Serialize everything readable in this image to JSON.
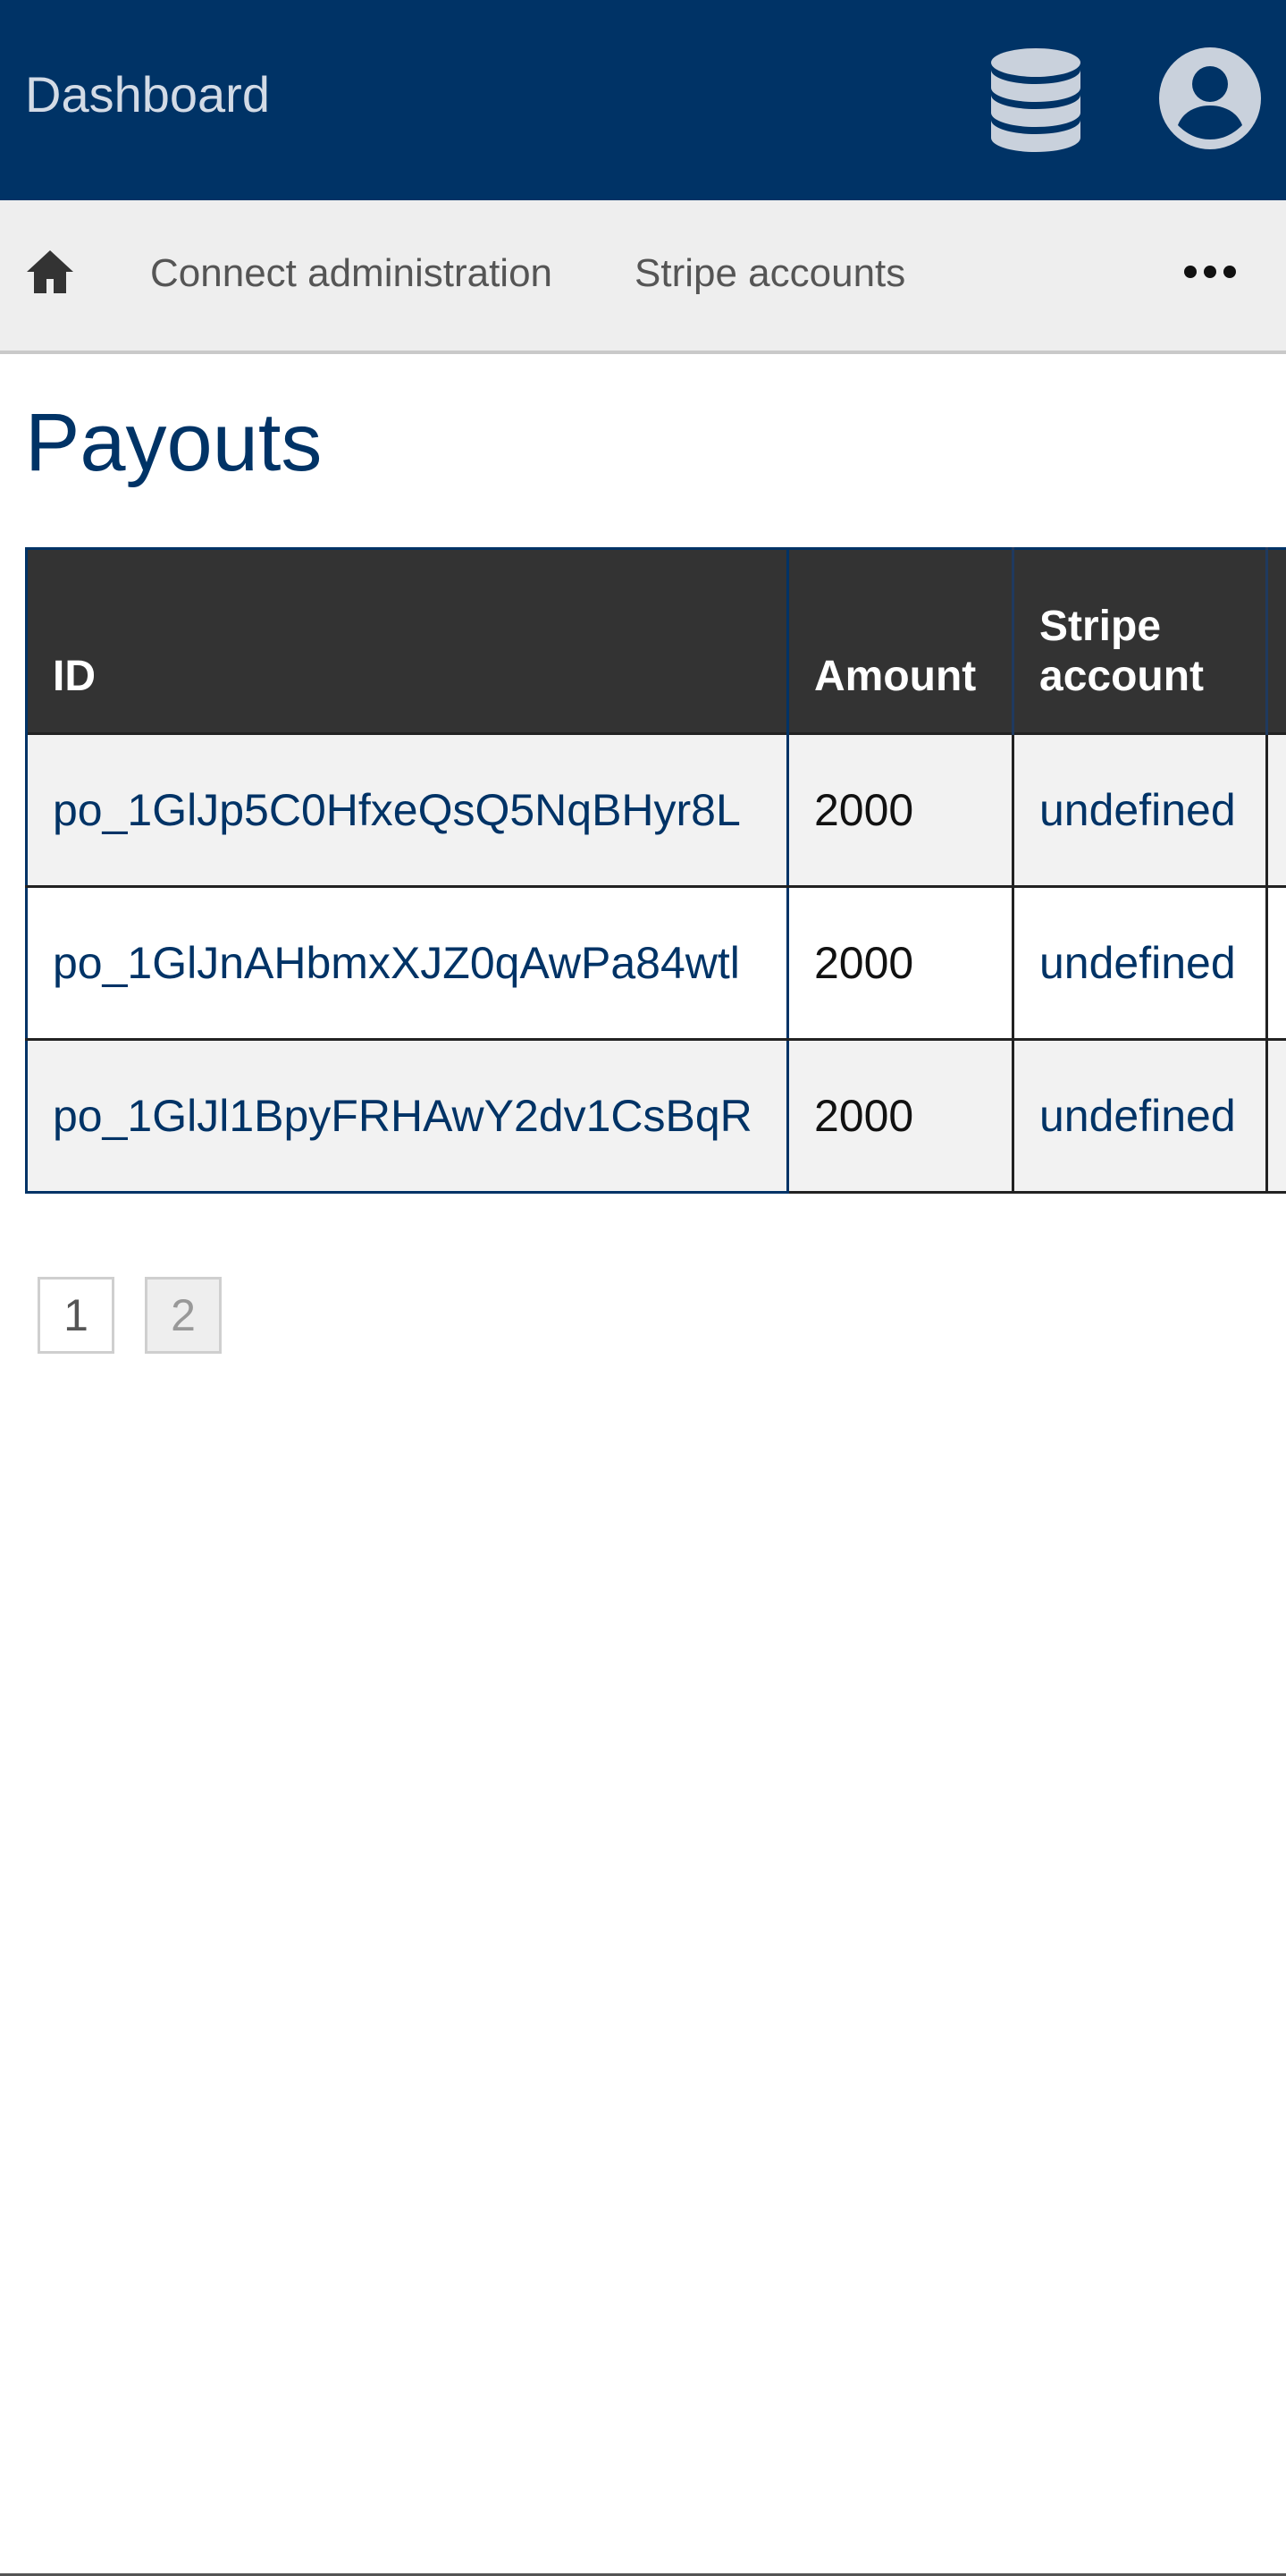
{
  "header": {
    "title": "Dashboard",
    "icons": [
      "database-icon",
      "account-circle-icon"
    ]
  },
  "breadcrumb": {
    "home_icon": "home-icon",
    "items": [
      "Connect administration",
      "Stripe accounts"
    ],
    "more_icon": "more-horizontal-icon"
  },
  "page": {
    "title": "Payouts"
  },
  "table": {
    "columns": [
      "ID",
      "Amount",
      "Stripe account"
    ],
    "rows": [
      {
        "id": "po_1GlJp5C0HfxeQsQ5NqBHyr8L",
        "amount": "2000",
        "stripe_account": "undefined"
      },
      {
        "id": "po_1GlJnAHbmxXJZ0qAwPa84wtl",
        "amount": "2000",
        "stripe_account": "undefined"
      },
      {
        "id": "po_1GlJl1BpyFRHAwY2dv1CsBqR",
        "amount": "2000",
        "stripe_account": "undefined"
      }
    ]
  },
  "pagination": {
    "pages": [
      "1",
      "2"
    ],
    "current": "2"
  },
  "colors": {
    "header_bg": "#003366",
    "breadcrumb_bg": "#eeeeee",
    "table_header_bg": "#333333",
    "link": "#003366"
  }
}
